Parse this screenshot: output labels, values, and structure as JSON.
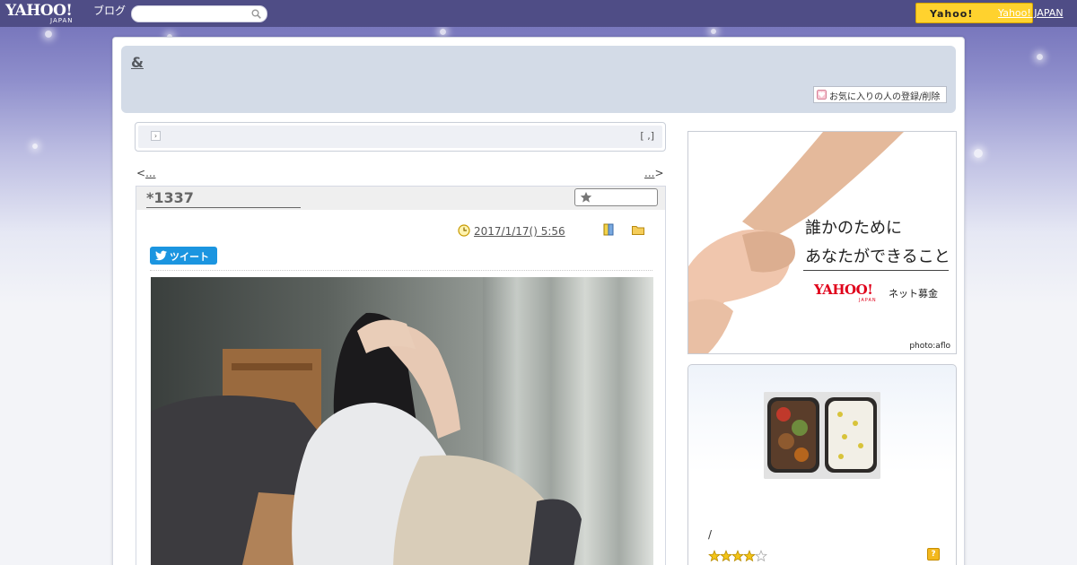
{
  "header": {
    "logo_text": "YAHOO!",
    "logo_sub": "JAPAN",
    "service_name": "ブログ",
    "search_placeholder": "",
    "yahoo_button_label": "Yahoo!",
    "yahoo_japan_link": "Yahoo! JAPAN"
  },
  "blog": {
    "title": "&",
    "favorite_button_label": "お気に入りの人の登録/削除"
  },
  "notice": {
    "arrow_glyph": "›",
    "right_text": "[ ,]"
  },
  "nav": {
    "prev_symbol": "<",
    "prev_label": "...",
    "next_label": "...",
    "next_symbol": ">"
  },
  "article": {
    "title": "*1337",
    "date": "2017/1/17()  5:56",
    "tweet_label": "ツイート"
  },
  "ad": {
    "line1": "誰かのために",
    "line2": "あなたができること",
    "logo": "YAHOO!",
    "logo_sub": "JAPAN",
    "service": "ネット募金",
    "credit": "photo:aflo"
  },
  "profile": {
    "text": "/",
    "rating": 4,
    "rating_max": 5,
    "help_label": "?"
  },
  "colors": {
    "topbar": "#4f4d86",
    "header_box": "#d3dbe7",
    "yahoo_button": "#ffd22e",
    "tweet_button": "#1b95e0",
    "ad_logo_red": "#e0001a"
  }
}
